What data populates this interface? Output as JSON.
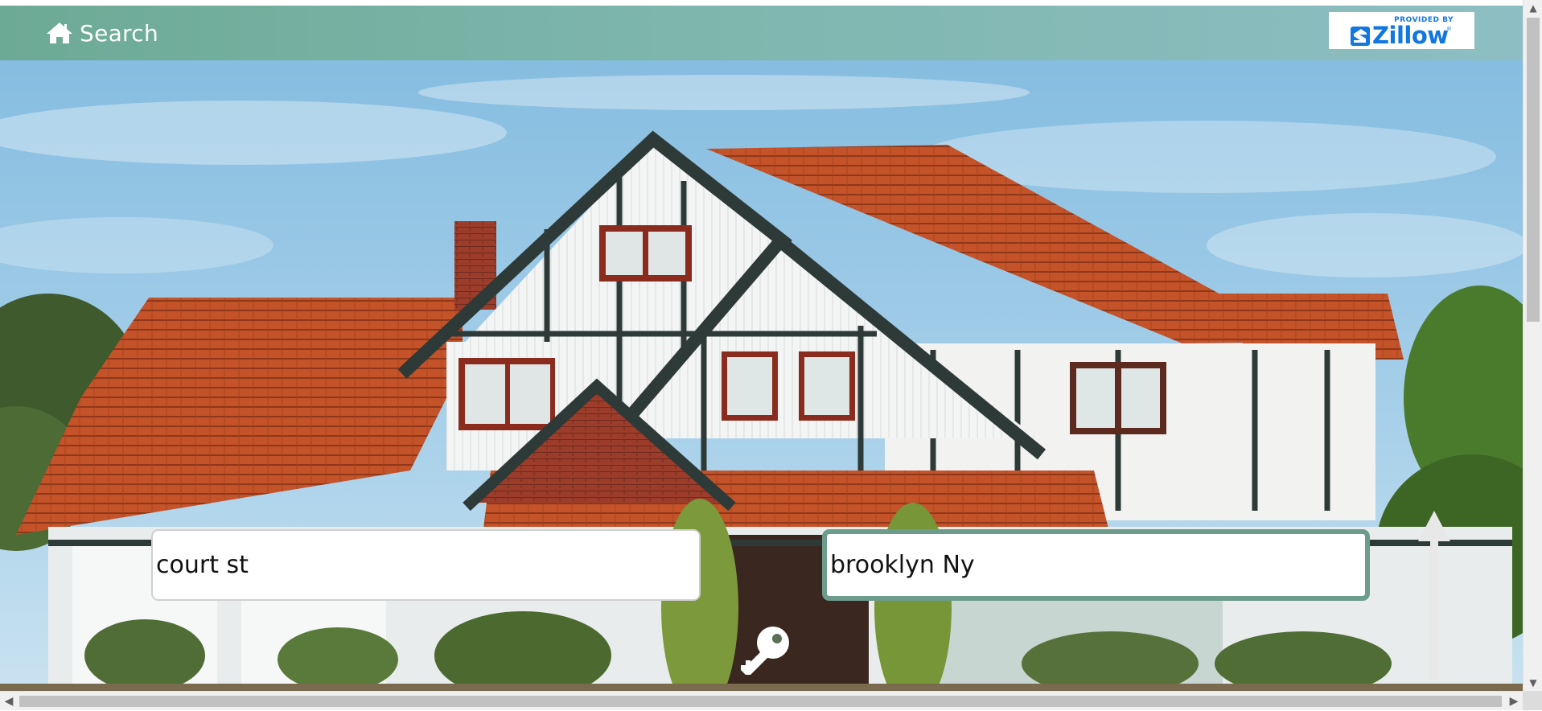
{
  "nav": {
    "home_icon": "home-icon",
    "title": "Search"
  },
  "provider": {
    "provided_by": "PROVIDED BY",
    "name": "Zillow",
    "registered": "®",
    "logo_icon": "zillow-z-icon"
  },
  "hero": {
    "image": "two-story tudor-style house with red tile roof under blue sky"
  },
  "search": {
    "street_value": "court st",
    "city_value": "brooklyn Ny",
    "submit_icon": "key-icon"
  },
  "colors": {
    "nav_start": "#6daa95",
    "nav_end": "#8dbec3",
    "focus_border": "#6d9b8c",
    "zillow_blue": "#1277e1"
  },
  "scrollbars": {
    "vertical_up": "▲",
    "vertical_down": "▼",
    "horizontal_left": "◀",
    "horizontal_right": "▶"
  }
}
